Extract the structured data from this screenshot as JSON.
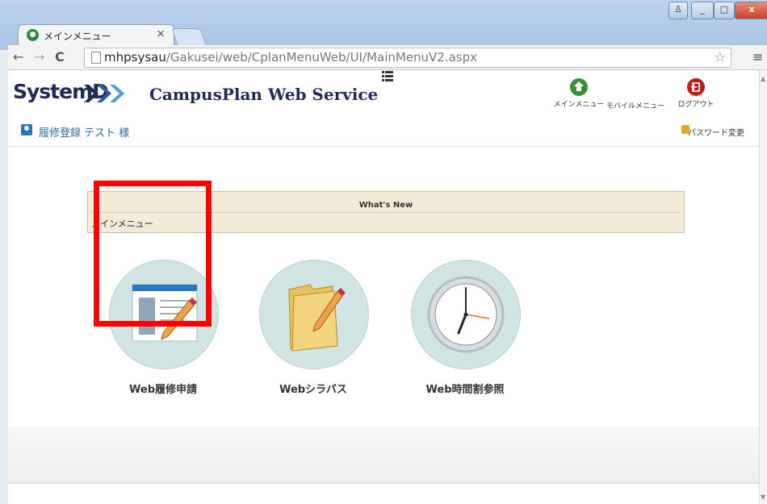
{
  "browser": {
    "tab_title": "メインメニュー",
    "tab_close": "×",
    "url_host": "mhpsysau",
    "url_path": "/Gakusei/web/CplanMenuWeb/UI/MainMenuV2.aspx",
    "back": "←",
    "forward": "→",
    "reload": "C",
    "star": "☆",
    "menu": "≡",
    "window_controls": {
      "user": "♙",
      "minimize": "_",
      "maximize": "□",
      "close": "x"
    }
  },
  "header": {
    "logo_text": "SystemD",
    "service_name": "CampusPlan Web Service",
    "buttons": [
      {
        "label": "メインメニュー",
        "icon": "home-icon",
        "color": "#3a8f3a"
      },
      {
        "label": "モバイルメニュー",
        "icon": "",
        "color": ""
      },
      {
        "label": "ログアウト",
        "icon": "logout-icon",
        "color": "#b81e1e"
      }
    ]
  },
  "userbar": {
    "user_text": "履修登録  テスト 様",
    "password_link": "パスワード変更"
  },
  "whats_new": {
    "title": "What's New",
    "body": "メインメニュー"
  },
  "tiles": [
    {
      "label": "Web履修申請",
      "icon": "registration-pencil-icon"
    },
    {
      "label": "Webシラバス",
      "icon": "folder-pencil-icon"
    },
    {
      "label": "Web時間割参照",
      "icon": "clock-icon"
    }
  ],
  "colors": {
    "tile_circle": "#cfe4e3",
    "highlight": "#ff0000",
    "whats_new_bg": "#f3ebd8",
    "brand": "#1f2a55"
  }
}
